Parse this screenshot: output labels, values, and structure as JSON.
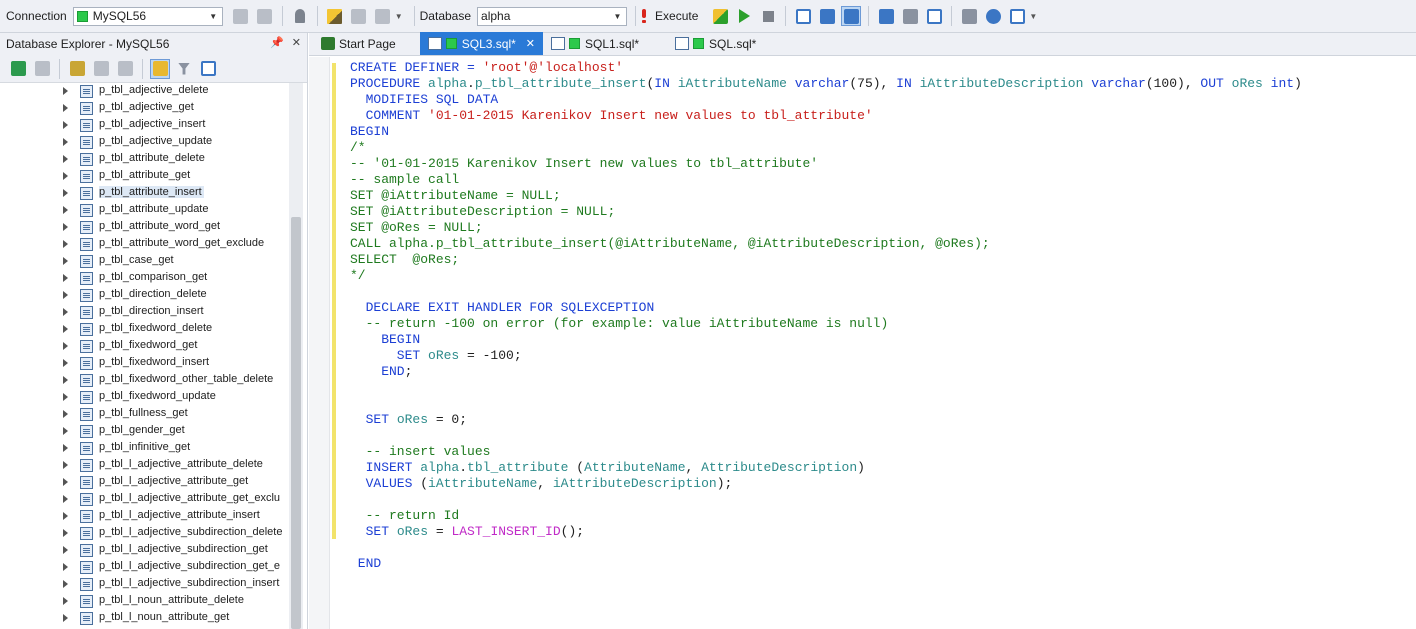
{
  "toolbar": {
    "connection_label": "Connection",
    "connection_value": "MySQL56",
    "database_label": "Database",
    "database_value": "alpha",
    "execute_label": "Execute"
  },
  "explorer": {
    "title": "Database Explorer - MySQL56",
    "items": [
      "p_tbl_adjective_delete",
      "p_tbl_adjective_get",
      "p_tbl_adjective_insert",
      "p_tbl_adjective_update",
      "p_tbl_attribute_delete",
      "p_tbl_attribute_get",
      "p_tbl_attribute_insert",
      "p_tbl_attribute_update",
      "p_tbl_attribute_word_get",
      "p_tbl_attribute_word_get_exclude",
      "p_tbl_case_get",
      "p_tbl_comparison_get",
      "p_tbl_direction_delete",
      "p_tbl_direction_insert",
      "p_tbl_fixedword_delete",
      "p_tbl_fixedword_get",
      "p_tbl_fixedword_insert",
      "p_tbl_fixedword_other_table_delete",
      "p_tbl_fixedword_update",
      "p_tbl_fullness_get",
      "p_tbl_gender_get",
      "p_tbl_infinitive_get",
      "p_tbl_l_adjective_attribute_delete",
      "p_tbl_l_adjective_attribute_get",
      "p_tbl_l_adjective_attribute_get_exclu",
      "p_tbl_l_adjective_attribute_insert",
      "p_tbl_l_adjective_subdirection_delete",
      "p_tbl_l_adjective_subdirection_get",
      "p_tbl_l_adjective_subdirection_get_e",
      "p_tbl_l_adjective_subdirection_insert",
      "p_tbl_l_noun_attribute_delete",
      "p_tbl_l_noun_attribute_get"
    ],
    "selected_index": 6
  },
  "tabs": [
    {
      "label": "Start Page",
      "active": false
    },
    {
      "label": "SQL3.sql*",
      "active": true
    },
    {
      "label": "SQL1.sql*",
      "active": false
    },
    {
      "label": "SQL.sql*",
      "active": false
    }
  ],
  "editor": {
    "lines": [
      [
        [
          "kw",
          "CREATE DEFINER = "
        ],
        [
          "str",
          "'root'@'localhost'"
        ]
      ],
      [
        [
          "kw",
          "PROCEDURE "
        ],
        [
          "id",
          "alpha"
        ],
        [
          "plain",
          "."
        ],
        [
          "id",
          "p_tbl_attribute_insert"
        ],
        [
          "plain",
          "("
        ],
        [
          "kw",
          "IN "
        ],
        [
          "id",
          "iAttributeName "
        ],
        [
          "kw",
          "varchar"
        ],
        [
          "plain",
          "(75), "
        ],
        [
          "kw",
          "IN "
        ],
        [
          "id",
          "iAttributeDescription "
        ],
        [
          "kw",
          "varchar"
        ],
        [
          "plain",
          "(100), "
        ],
        [
          "kw",
          "OUT "
        ],
        [
          "id",
          "oRes "
        ],
        [
          "kw",
          "int"
        ],
        [
          "plain",
          ")"
        ]
      ],
      [
        [
          "kw",
          "  MODIFIES SQL DATA"
        ]
      ],
      [
        [
          "kw",
          "  COMMENT "
        ],
        [
          "str",
          "'01-01-2015 Karenikov Insert new values to tbl_attribute'"
        ]
      ],
      [
        [
          "kw",
          "BEGIN"
        ]
      ],
      [
        [
          "cmt",
          "/*"
        ]
      ],
      [
        [
          "cmt",
          "-- '01-01-2015 Karenikov Insert new values to tbl_attribute'"
        ]
      ],
      [
        [
          "cmt",
          "-- sample call"
        ]
      ],
      [
        [
          "cmt",
          "SET @iAttributeName = NULL;"
        ]
      ],
      [
        [
          "cmt",
          "SET @iAttributeDescription = NULL;"
        ]
      ],
      [
        [
          "cmt",
          "SET @oRes = NULL;"
        ]
      ],
      [
        [
          "cmt",
          "CALL alpha.p_tbl_attribute_insert(@iAttributeName, @iAttributeDescription, @oRes);"
        ]
      ],
      [
        [
          "cmt",
          "SELECT  @oRes;"
        ]
      ],
      [
        [
          "cmt",
          "*/"
        ]
      ],
      [
        [
          "plain",
          ""
        ]
      ],
      [
        [
          "kw",
          "  DECLARE EXIT HANDLER FOR SQLEXCEPTION"
        ]
      ],
      [
        [
          "cmt",
          "  -- return -100 on error (for example: value iAttributeName is null)"
        ]
      ],
      [
        [
          "kw",
          "    BEGIN"
        ]
      ],
      [
        [
          "kw",
          "      SET "
        ],
        [
          "id",
          "oRes "
        ],
        [
          "plain",
          "= -100;"
        ]
      ],
      [
        [
          "kw",
          "    END"
        ],
        [
          "plain",
          ";"
        ]
      ],
      [
        [
          "plain",
          ""
        ]
      ],
      [
        [
          "plain",
          ""
        ]
      ],
      [
        [
          "kw",
          "  SET "
        ],
        [
          "id",
          "oRes "
        ],
        [
          "plain",
          "= 0;"
        ]
      ],
      [
        [
          "plain",
          ""
        ]
      ],
      [
        [
          "cmt",
          "  -- insert values"
        ]
      ],
      [
        [
          "kw",
          "  INSERT "
        ],
        [
          "id",
          "alpha"
        ],
        [
          "plain",
          "."
        ],
        [
          "id",
          "tbl_attribute "
        ],
        [
          "plain",
          "("
        ],
        [
          "id",
          "AttributeName"
        ],
        [
          "plain",
          ", "
        ],
        [
          "id",
          "AttributeDescription"
        ],
        [
          "plain",
          ")"
        ]
      ],
      [
        [
          "kw",
          "  VALUES "
        ],
        [
          "plain",
          "("
        ],
        [
          "id",
          "iAttributeName"
        ],
        [
          "plain",
          ", "
        ],
        [
          "id",
          "iAttributeDescription"
        ],
        [
          "plain",
          ");"
        ]
      ],
      [
        [
          "plain",
          ""
        ]
      ],
      [
        [
          "cmt",
          "  -- return Id"
        ]
      ],
      [
        [
          "kw",
          "  SET "
        ],
        [
          "id",
          "oRes "
        ],
        [
          "plain",
          "= "
        ],
        [
          "fn",
          "LAST_INSERT_ID"
        ],
        [
          "plain",
          "();"
        ]
      ],
      [
        [
          "plain",
          ""
        ]
      ],
      [
        [
          "kw",
          " END"
        ]
      ]
    ]
  }
}
